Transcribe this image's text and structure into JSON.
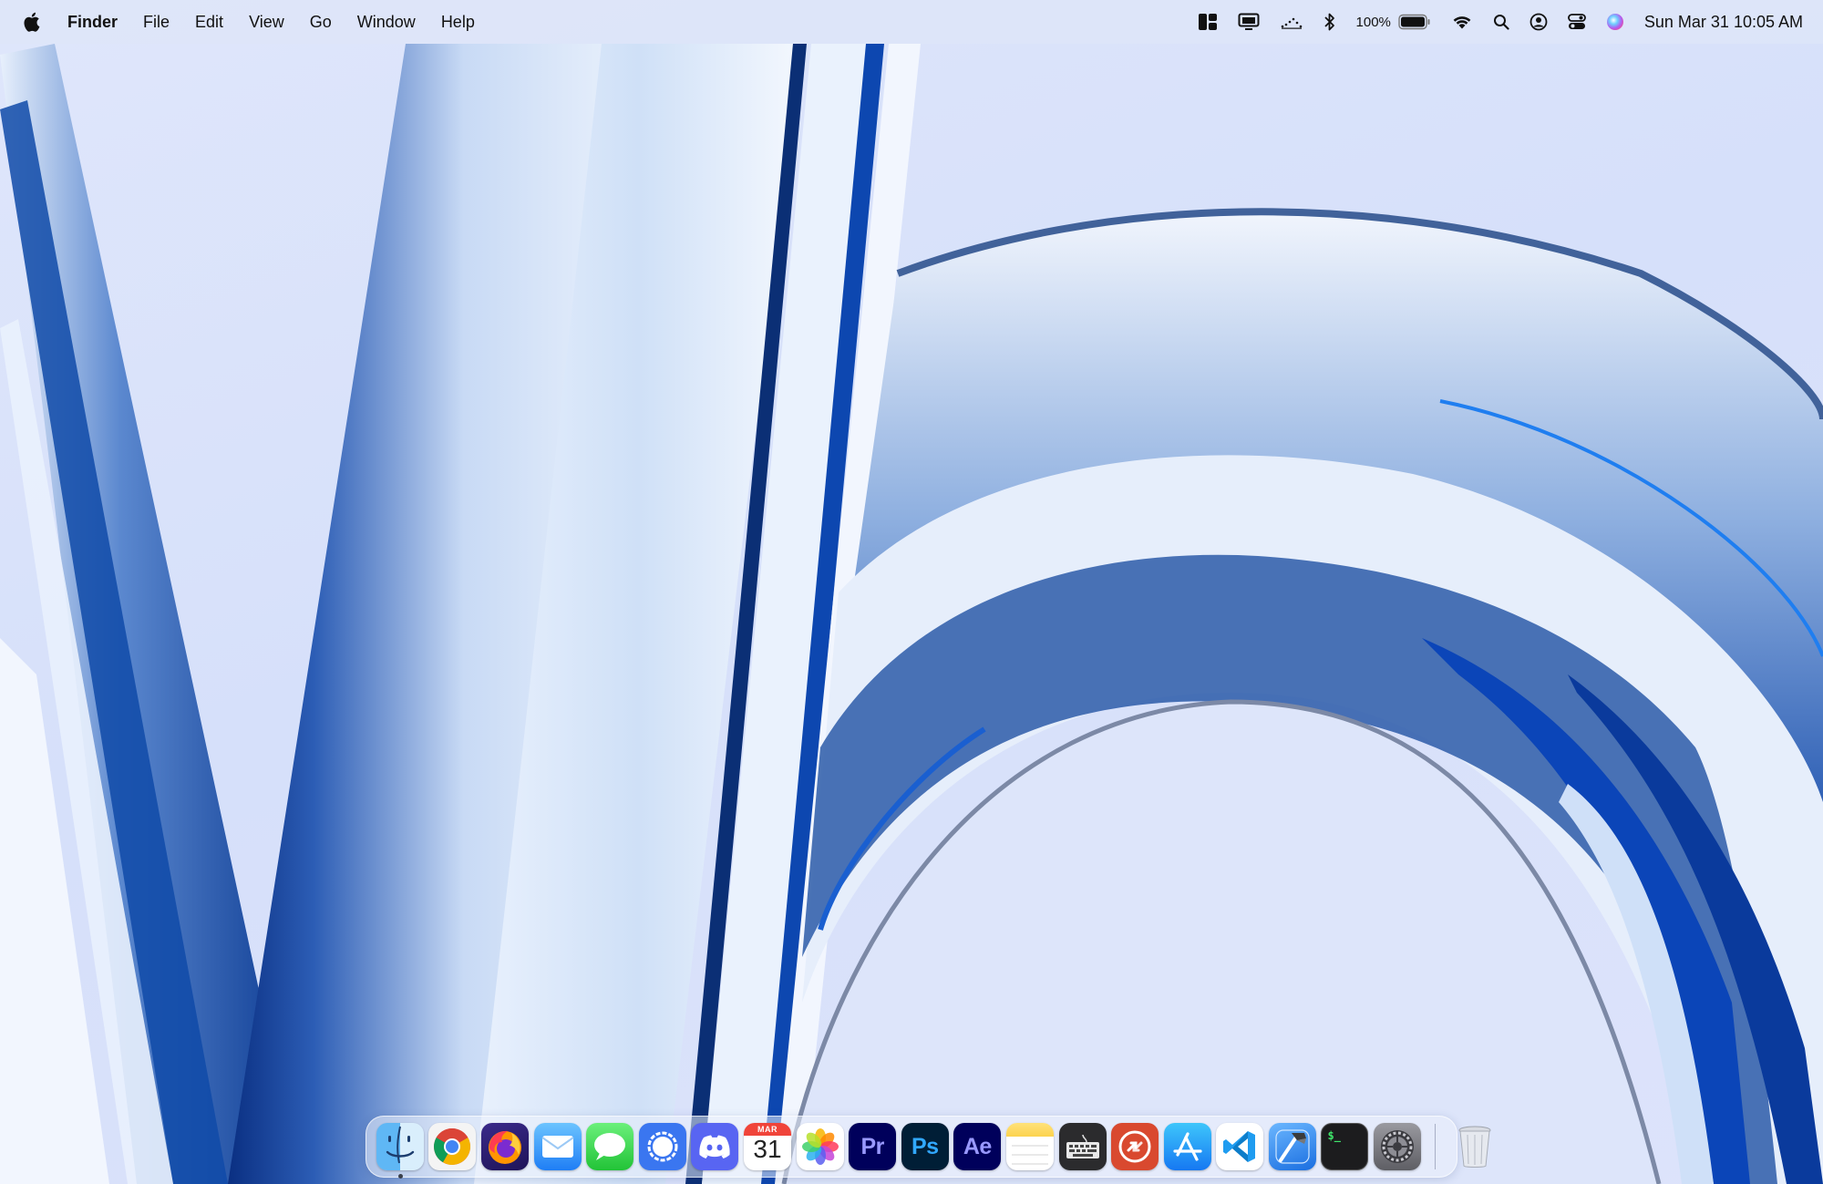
{
  "menubar": {
    "apple_icon": "apple-logo-icon",
    "app_name": "Finder",
    "menus": [
      "File",
      "Edit",
      "View",
      "Go",
      "Window",
      "Help"
    ],
    "status_icons": [
      "window-layout-icon",
      "display-icon",
      "activity-icon",
      "bluetooth-icon"
    ],
    "battery": {
      "percent_label": "100%",
      "level": 1.0
    },
    "status_icons_right": [
      "wifi-icon",
      "spotlight-search-icon",
      "user-account-icon",
      "control-center-icon",
      "siri-icon"
    ],
    "clock": "Sun Mar 31  10:05 AM"
  },
  "dock": {
    "apps": [
      {
        "name": "Finder",
        "icon": "finder-icon",
        "running": true
      },
      {
        "name": "Google Chrome",
        "icon": "chrome-icon"
      },
      {
        "name": "Firefox",
        "icon": "firefox-icon"
      },
      {
        "name": "Mail",
        "icon": "mail-icon"
      },
      {
        "name": "Messages",
        "icon": "messages-icon"
      },
      {
        "name": "Signal",
        "icon": "signal-icon"
      },
      {
        "name": "Discord",
        "icon": "discord-icon"
      },
      {
        "name": "Calendar",
        "icon": "calendar-icon",
        "month": "MAR",
        "day": "31"
      },
      {
        "name": "Photos",
        "icon": "photos-icon"
      },
      {
        "name": "Premiere Pro",
        "icon": "premiere-icon",
        "label": "Pr"
      },
      {
        "name": "Photoshop",
        "icon": "photoshop-icon",
        "label": "Ps"
      },
      {
        "name": "After Effects",
        "icon": "after-effects-icon",
        "label": "Ae"
      },
      {
        "name": "Notes",
        "icon": "notes-icon"
      },
      {
        "name": "Keyboard",
        "icon": "keyboard-icon"
      },
      {
        "name": "Remote Desktop",
        "icon": "remote-desktop-icon"
      },
      {
        "name": "App Store",
        "icon": "app-store-icon"
      },
      {
        "name": "Visual Studio Code",
        "icon": "vscode-icon"
      },
      {
        "name": "Xcode",
        "icon": "xcode-icon"
      },
      {
        "name": "Terminal",
        "icon": "terminal-icon",
        "prompt": "$_"
      },
      {
        "name": "System Settings",
        "icon": "settings-icon"
      }
    ],
    "trash": {
      "name": "Trash",
      "icon": "trash-icon"
    }
  },
  "colors": {
    "wallpaper_bg": "#dde3fb",
    "ribbon_dark": "#0a3c96",
    "ribbon_mid": "#3f6fc0",
    "ribbon_light": "#eef3fd",
    "premiere_bg": "#00005b",
    "premiere_fg": "#9999ff",
    "photoshop_bg": "#001e36",
    "photoshop_fg": "#31a8ff",
    "after_effects_bg": "#00005b",
    "after_effects_fg": "#9999ff"
  }
}
